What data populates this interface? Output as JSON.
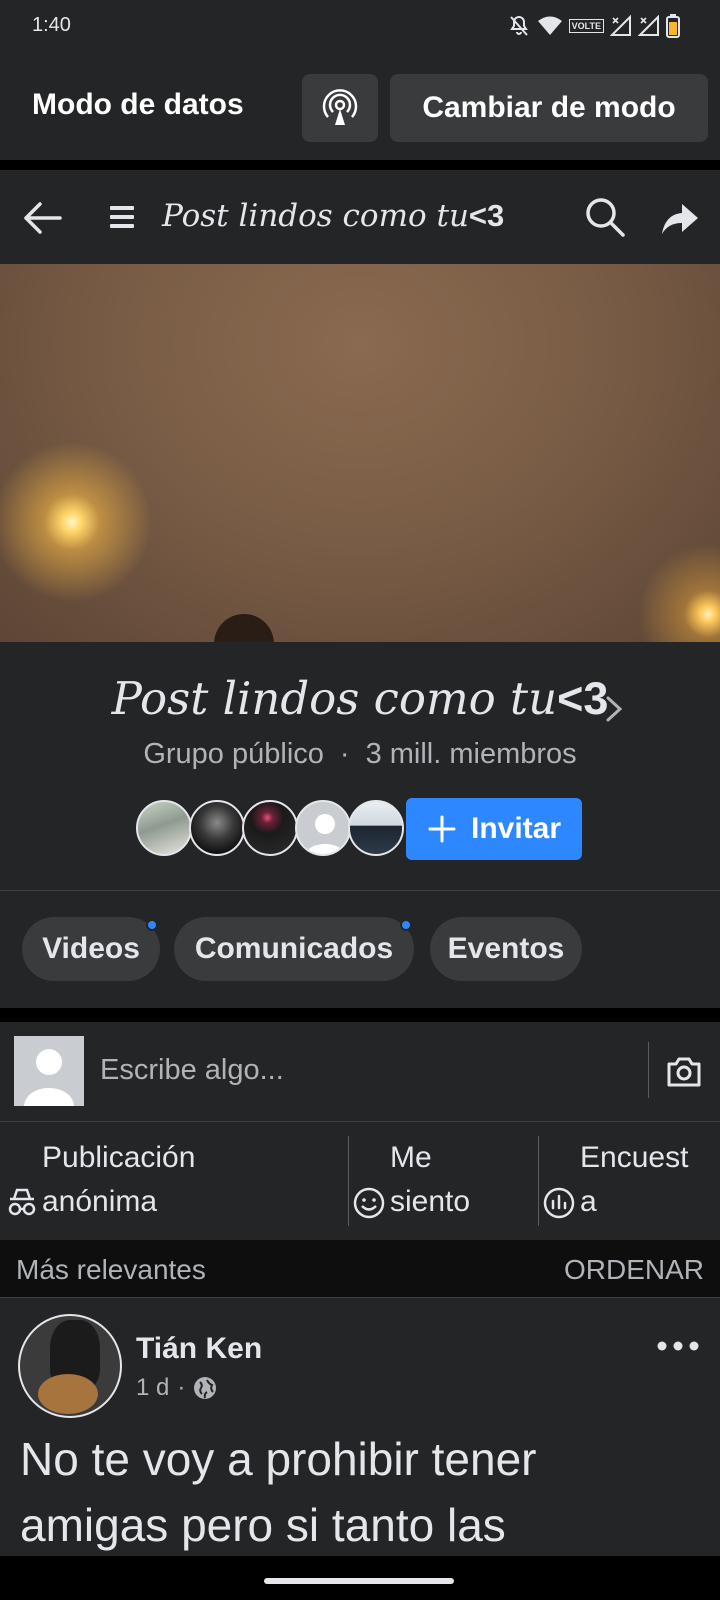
{
  "status_bar": {
    "time": "1:40",
    "volte_label": "VOLTE"
  },
  "data_mode_bar": {
    "title": "Modo de datos",
    "radar_icon": "radar-icon",
    "switch_button": "Cambiar de modo"
  },
  "nav": {
    "back_icon": "arrow-left-icon",
    "menu_icon": "menu-icon",
    "title_script": "Post lindos como tu",
    "title_suffix": "<3",
    "search_icon": "search-icon",
    "share_icon": "share-icon"
  },
  "group": {
    "name_script": "Post lindos como tu",
    "name_suffix": "<3",
    "privacy": "Grupo público",
    "separator": "·",
    "members": "3 mill. miembros",
    "invite_label": "Invitar"
  },
  "chips": [
    {
      "label": "Videos",
      "has_dot": true
    },
    {
      "label": "Comunicados",
      "has_dot": true
    },
    {
      "label": "Eventos",
      "has_dot": false
    }
  ],
  "composer": {
    "placeholder": "Escribe algo...",
    "camera_icon": "camera-icon"
  },
  "actions": [
    {
      "line1": "Publicación",
      "line2": "anónima",
      "icon": "incognito-icon"
    },
    {
      "line1": "Me",
      "line2": "siento",
      "icon": "smiley-icon"
    },
    {
      "line1": "Encuest",
      "line2": "a",
      "icon": "poll-icon"
    }
  ],
  "sort": {
    "label": "Más relevantes",
    "action": "ORDENAR"
  },
  "post": {
    "author": "Tián Ken",
    "time": "1 d",
    "dot": "·",
    "audience_icon": "globe-icon",
    "text_line1": "No te voy a prohibir tener",
    "text_line2": "amigas pero si tanto las"
  },
  "colors": {
    "accent": "#2d88ff",
    "background": "#18191a",
    "surface": "#242526",
    "chip": "#3a3b3c",
    "text": "#e4e6eb",
    "muted": "#b0b3b8"
  }
}
